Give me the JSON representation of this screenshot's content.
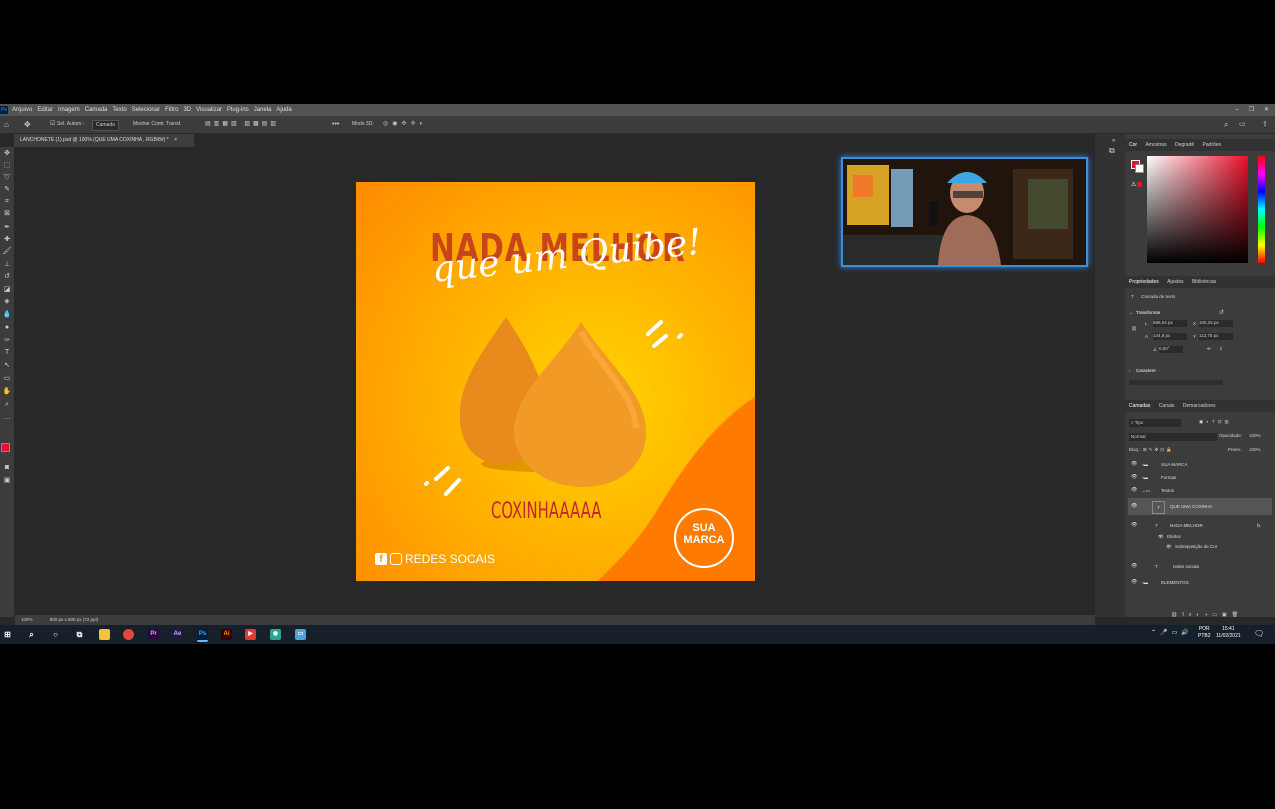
{
  "menubar": {
    "app_logo": "Ps",
    "items": [
      "Arquivo",
      "Editar",
      "Imagem",
      "Camada",
      "Texto",
      "Selecionar",
      "Filtro",
      "3D",
      "Visualizar",
      "Plug-ins",
      "Janela",
      "Ajuda"
    ],
    "window_controls": [
      "–",
      "❐",
      "✕"
    ]
  },
  "options_bar": {
    "auto_select_label": "Sel. Autom.:",
    "auto_select_value": "Camada",
    "transform_controls_label": "Mostrar Contr. Transf.",
    "mode_3d_label": "Modo 3D:"
  },
  "document_tab": {
    "title": "LANCHONETE (1).psd @ 100% (QUE UMA COXINHA , RGB/8#) *",
    "close": "×"
  },
  "status_bar": {
    "zoom": "100%",
    "doc_size": "800 px x 800 px (72 ppi)"
  },
  "artwork": {
    "headline": "NADA MELHOR",
    "script_line": "que um Quibe!",
    "product_label": "COXINHAAAAA",
    "social_text": "REDES SOCAIS",
    "brand_line1": "SUA",
    "brand_line2": "MARCA",
    "colors": {
      "headline": "#c8451a",
      "label": "#c0282f",
      "wave": "#ff7a00"
    }
  },
  "color_panel": {
    "tabs": [
      "Cor",
      "Amostras",
      "Degradê",
      "Padrões"
    ],
    "active_tab": "Cor",
    "foreground": "#e8102a",
    "background": "#ffffff"
  },
  "properties_panel": {
    "tabs": [
      "Propriedades",
      "Ajustes",
      "Bibliotecas"
    ],
    "active_tab": "Propriedades",
    "layer_type": "Camada de texto",
    "transform_title": "Transformar",
    "w_label": "L",
    "w_value": "596,04 px",
    "x_label": "X",
    "x_value": "100,25 px",
    "h_label": "A",
    "h_value": "144,8 px",
    "y_label": "Y",
    "y_value": "113,75 px",
    "angle_value": "0,00°",
    "character_title": "Caractere"
  },
  "layers_panel": {
    "tabs": [
      "Camadas",
      "Canais",
      "Demarcadores"
    ],
    "active_tab": "Camadas",
    "filter_kind": "Tipo",
    "blend_mode": "Normal",
    "opacity_label": "Opacidade:",
    "opacity_value": "100%",
    "lock_label": "Bloq.:",
    "fill_label": "Preen.:",
    "fill_value": "100%",
    "layers": [
      {
        "name": "SUA MARCA",
        "kind": "folder"
      },
      {
        "name": "Formas",
        "kind": "folder"
      },
      {
        "name": "Textos",
        "kind": "folder"
      },
      {
        "name": "QUE UMA COXINHA",
        "kind": "text"
      },
      {
        "name": "NADA MELHOR",
        "kind": "text"
      },
      {
        "name": "Efeitos",
        "kind": "effect"
      },
      {
        "name": "Sobreposição de Cor",
        "kind": "effect"
      },
      {
        "name": "redes sociais",
        "kind": "text"
      },
      {
        "name": "ELEMENTOS",
        "kind": "folder"
      }
    ]
  },
  "taskbar": {
    "apps": [
      "Pr",
      "Ae",
      "Ps",
      "Ai"
    ],
    "lang": "POR",
    "lang2": "PTB2",
    "time": "15:41",
    "date": "11/02/2021"
  }
}
